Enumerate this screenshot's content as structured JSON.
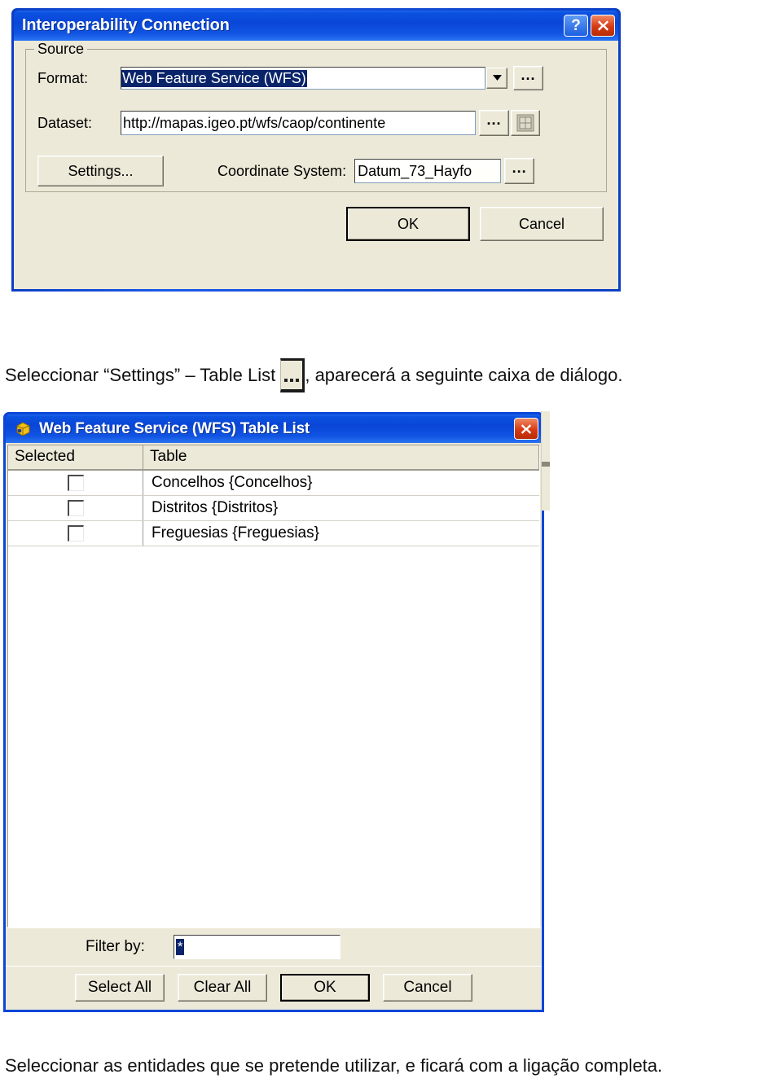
{
  "dialog_interop": {
    "title": "Interoperability Connection",
    "titlebar_buttons": [
      {
        "name": "help-icon",
        "label": "?"
      },
      {
        "name": "close-icon",
        "label": "X"
      }
    ],
    "group": {
      "legend": "Source",
      "format": {
        "label": "Format:",
        "value": "Web Feature Service (WFS)",
        "dropdown_icon": "chevron-down-icon",
        "browse_label": "..."
      },
      "dataset": {
        "label": "Dataset:",
        "value": "http://mapas.igeo.pt/wfs/caop/continente",
        "browse_label": "...",
        "picker_icon": "grid-picker-icon"
      },
      "settings_button": "Settings...",
      "coordinate_system": {
        "label": "Coordinate System:",
        "value": "Datum_73_Hayfo",
        "browse_label": "..."
      }
    },
    "ok_label": "OK",
    "cancel_label": "Cancel"
  },
  "caption_middle": {
    "before": "Seleccionar “Settings” – Table List",
    "icon": "ellipsis-button-icon",
    "after": ", aparecerá a seguinte caixa de diálogo."
  },
  "dialog_tablelist": {
    "title": "Web Feature Service (WFS) Table List",
    "app_icon": "wfs-app-icon",
    "close_label": "X",
    "grid": {
      "columns": [
        "Selected",
        "Table"
      ],
      "rows": [
        {
          "checked": false,
          "table": "Concelhos {Concelhos}"
        },
        {
          "checked": false,
          "table": "Distritos {Distritos}"
        },
        {
          "checked": false,
          "table": "Freguesias {Freguesias}"
        }
      ]
    },
    "filter": {
      "label": "Filter by:",
      "value": "*"
    },
    "buttons": {
      "select_all": "Select All",
      "clear_all": "Clear All",
      "ok": "OK",
      "cancel": "Cancel"
    }
  },
  "caption_bottom": {
    "text": "Seleccionar as entidades que se pretende utilizar, e ficará com a ligação completa."
  },
  "colors": {
    "titlebar_blue": "#0a46d7",
    "dialog_face": "#ece9d8",
    "selection_blue": "#0a246a",
    "close_red": "#d63a14"
  }
}
